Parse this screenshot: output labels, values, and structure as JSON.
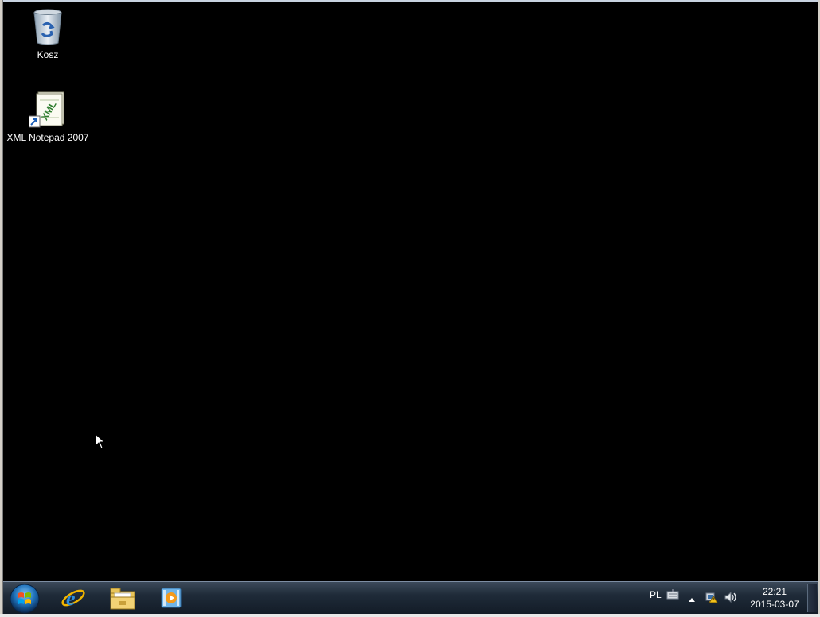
{
  "desktop": {
    "icons": [
      {
        "label": "Kosz",
        "icon": "recycle-bin-icon"
      },
      {
        "label": "XML Notepad 2007",
        "icon": "xml-notepad-icon"
      }
    ]
  },
  "taskbar": {
    "start": {
      "icon": "windows-start-orb-icon"
    },
    "pinned": [
      {
        "icon": "internet-explorer-icon"
      },
      {
        "icon": "windows-explorer-icon"
      },
      {
        "icon": "media-player-icon"
      }
    ],
    "tray": {
      "language": "PL",
      "keyboard_icon": "keyboard-icon",
      "expand_icon": "tray-expand-icon",
      "network_icon": "network-icon",
      "volume_icon": "volume-icon"
    },
    "clock": {
      "time": "22:21",
      "date": "2015-03-07"
    }
  },
  "colors": {
    "desktop_background": "#000000",
    "taskbar": "#1f2b39"
  }
}
